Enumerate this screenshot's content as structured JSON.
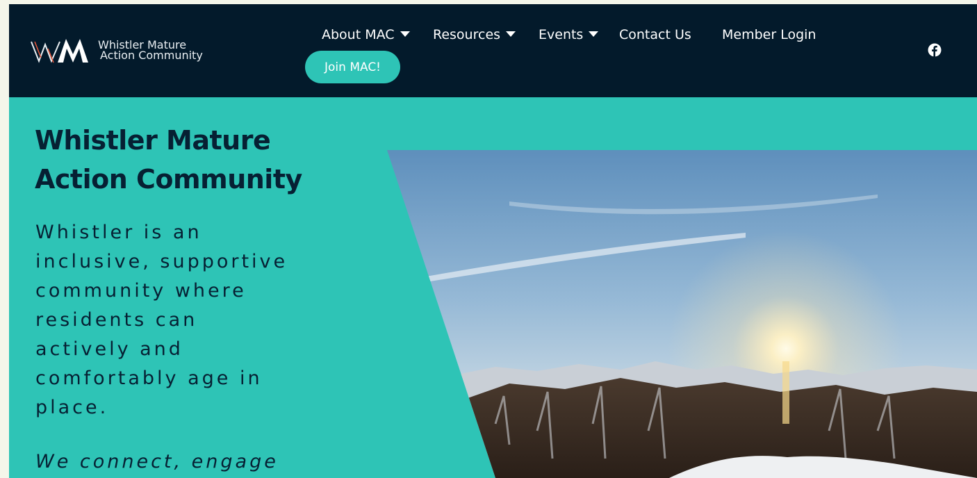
{
  "brand": {
    "line1": "Whistler Mature",
    "line2": "Action Community"
  },
  "nav": {
    "items": [
      {
        "label": "About MAC",
        "dropdown": true
      },
      {
        "label": "Resources",
        "dropdown": true
      },
      {
        "label": "Events",
        "dropdown": true
      },
      {
        "label": "Contact Us",
        "dropdown": false
      },
      {
        "label": "Member Login",
        "dropdown": false
      }
    ],
    "join_label": "Join MAC!",
    "social_icon": "facebook-icon"
  },
  "hero": {
    "title": "Whistler Mature Action Community",
    "text": "Whistler is an inclusive, supportive community where residents can actively and comfortably age in place.",
    "tagline": "We connect, engage"
  },
  "colors": {
    "nav_bg": "#031a2b",
    "accent": "#2ec4b6",
    "dark_text": "#062033"
  }
}
